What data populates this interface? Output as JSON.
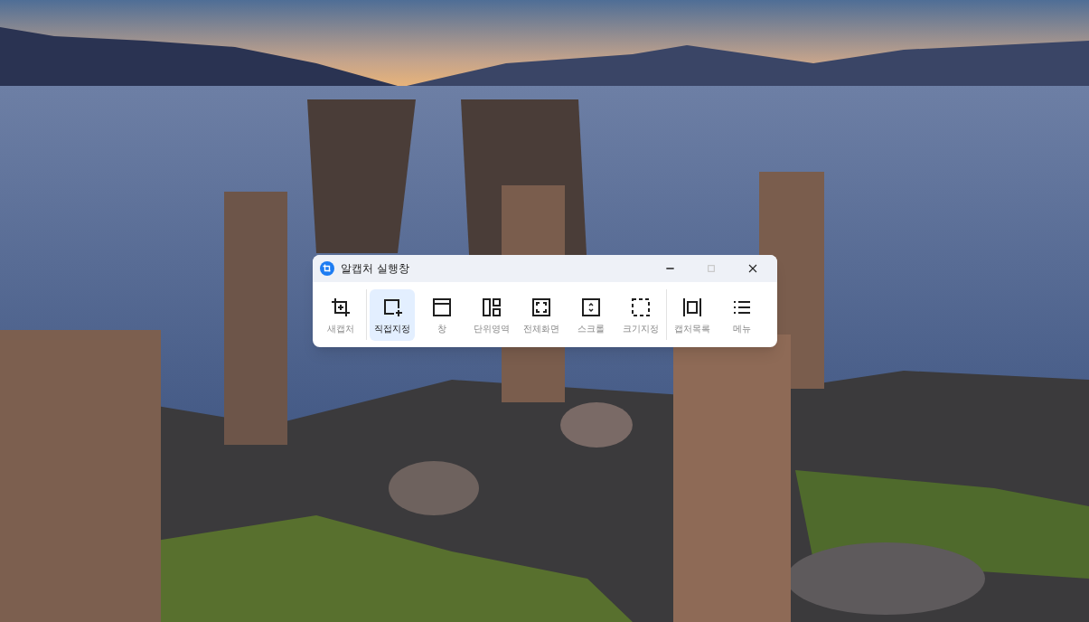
{
  "window": {
    "title": "알캡처 실행창",
    "controls": [
      {
        "kind": "minimize",
        "disabled": false
      },
      {
        "kind": "maximize",
        "disabled": true
      },
      {
        "kind": "close",
        "disabled": false
      }
    ]
  },
  "toolbar_groups": [
    [
      {
        "kind": "new",
        "label": "새캡처",
        "selected": false
      }
    ],
    [
      {
        "kind": "region",
        "label": "직접지정",
        "selected": true
      },
      {
        "kind": "window",
        "label": "창",
        "selected": false
      },
      {
        "kind": "unit",
        "label": "단위영역",
        "selected": false
      },
      {
        "kind": "full",
        "label": "전체화면",
        "selected": false
      },
      {
        "kind": "scroll",
        "label": "스크롤",
        "selected": false
      },
      {
        "kind": "size",
        "label": "크기지정",
        "selected": false
      }
    ],
    [
      {
        "kind": "list",
        "label": "캡처목록",
        "selected": false
      },
      {
        "kind": "menu",
        "label": "메뉴",
        "selected": false
      }
    ]
  ]
}
